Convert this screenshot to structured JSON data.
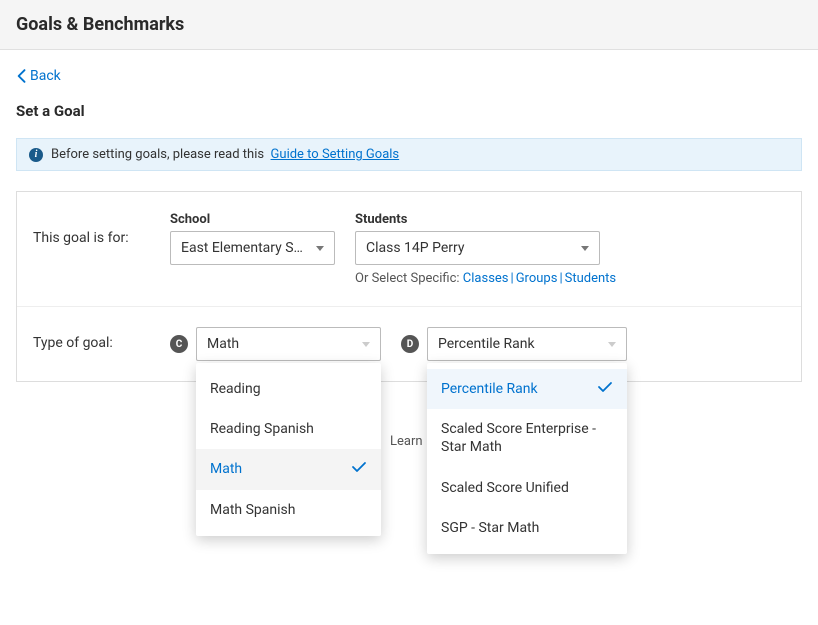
{
  "header": {
    "title": "Goals & Benchmarks"
  },
  "back": {
    "label": "Back"
  },
  "section": {
    "title": "Set a Goal"
  },
  "banner": {
    "text": "Before setting goals, please read this",
    "link": "Guide to Setting Goals"
  },
  "row1": {
    "label": "This goal is for:",
    "school_label": "School",
    "school_value": "East Elementary Sch…",
    "students_label": "Students",
    "students_value": "Class 14P Perry",
    "sublinks": {
      "prefix": "Or Select Specific:",
      "classes": "Classes",
      "groups": "Groups",
      "students": "Students"
    }
  },
  "row2": {
    "label": "Type of goal:",
    "badge_c": "C",
    "badge_d": "D",
    "subject_selected": "Math",
    "metric_selected": "Percentile Rank",
    "subject_options": {
      "o0": "Reading",
      "o1": "Reading Spanish",
      "o2": "Math",
      "o3": "Math Spanish"
    },
    "metric_options": {
      "o0": "Percentile Rank",
      "o1": "Scaled Score Enterprise - Star Math",
      "o2": "Scaled Score Unified",
      "o3": "SGP - Star Math"
    },
    "learn_fragment": "Learn"
  }
}
